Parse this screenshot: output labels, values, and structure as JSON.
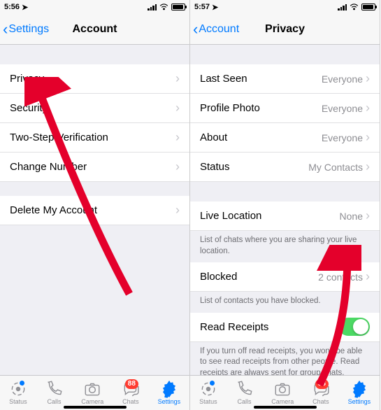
{
  "left": {
    "time": "5:56",
    "back": "Settings",
    "title": "Account",
    "rows": [
      {
        "label": "Privacy"
      },
      {
        "label": "Security"
      },
      {
        "label": "Two-Step Verification"
      },
      {
        "label": "Change Number"
      },
      {
        "label": "Delete My Account"
      }
    ]
  },
  "right": {
    "time": "5:57",
    "back": "Account",
    "title": "Privacy",
    "group1": [
      {
        "label": "Last Seen",
        "value": "Everyone"
      },
      {
        "label": "Profile Photo",
        "value": "Everyone"
      },
      {
        "label": "About",
        "value": "Everyone"
      },
      {
        "label": "Status",
        "value": "My Contacts"
      }
    ],
    "liveLocation": {
      "label": "Live Location",
      "value": "None"
    },
    "liveLocationNote": "List of chats where you are sharing your live location.",
    "blocked": {
      "label": "Blocked",
      "value": "2 contacts"
    },
    "blockedNote": "List of contacts you have blocked.",
    "readReceipts": {
      "label": "Read Receipts"
    },
    "readReceiptsNote": "If you turn off read receipts, you won't be able to see read receipts from other people. Read receipts are always sent for group chats."
  },
  "tabs": {
    "status": "Status",
    "calls": "Calls",
    "camera": "Camera",
    "chats": "Chats",
    "chatsBadge": "88",
    "settings": "Settings"
  }
}
